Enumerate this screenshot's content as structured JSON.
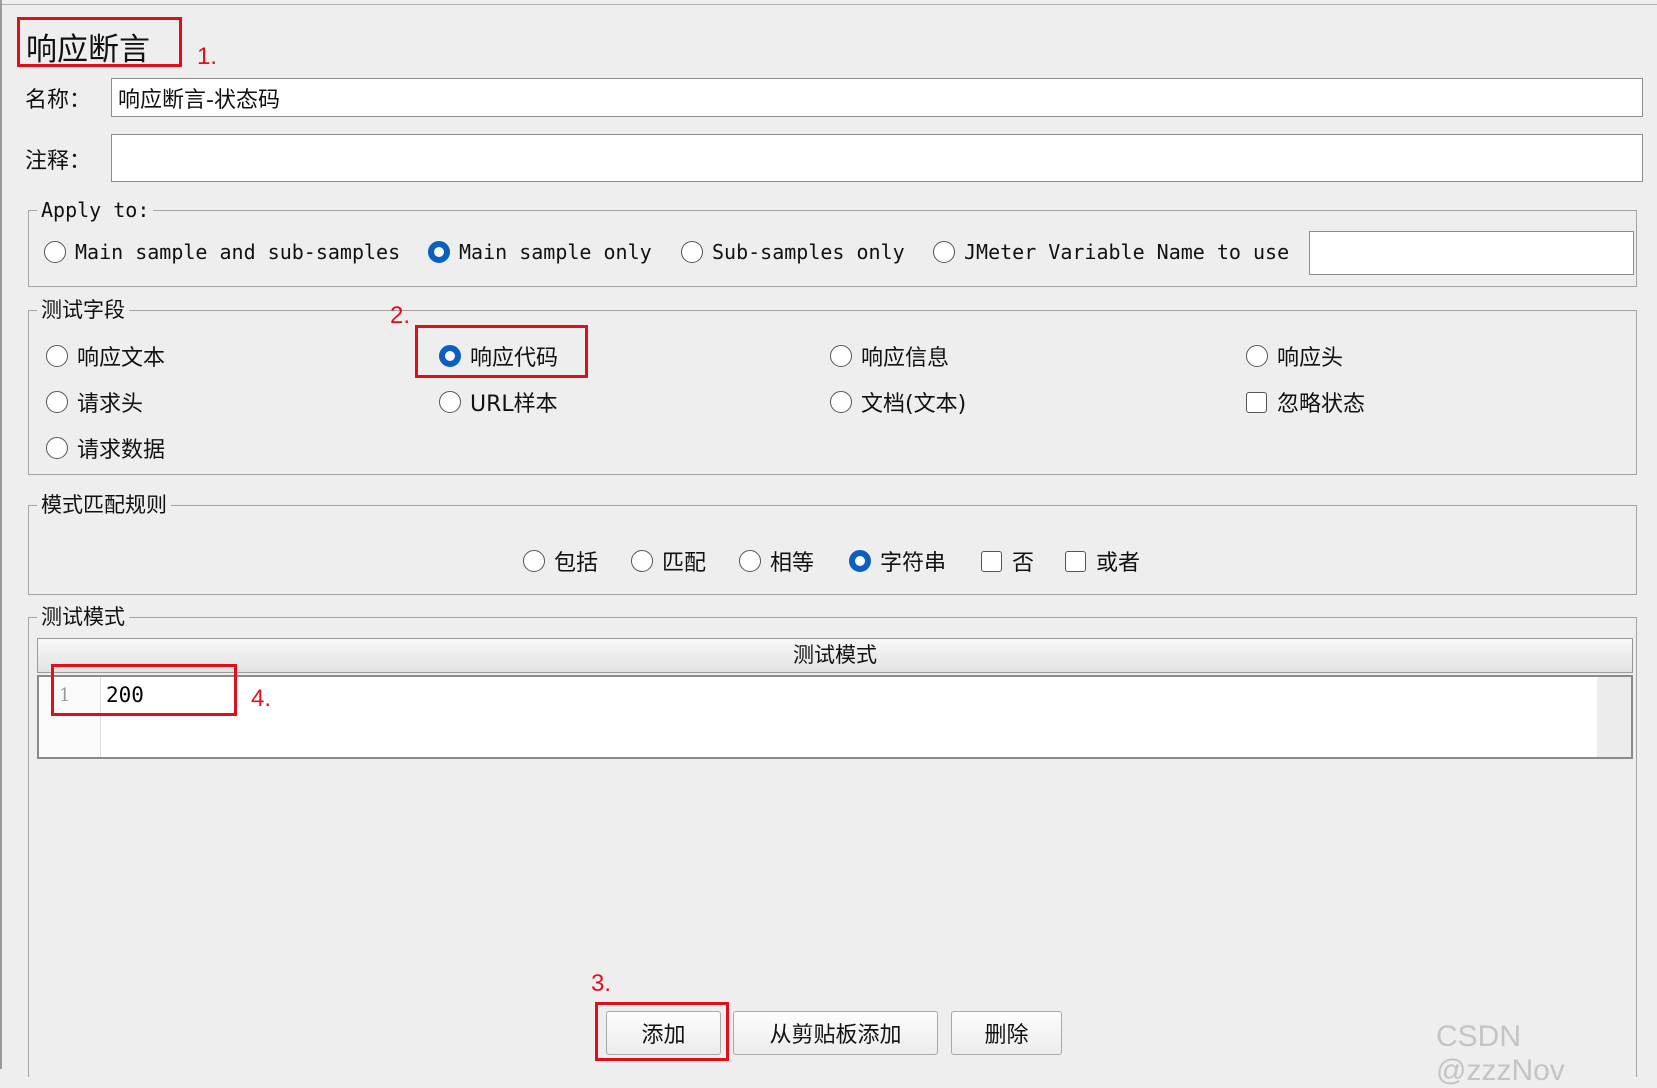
{
  "title": "响应断言",
  "name_field": {
    "label": "名称：",
    "value": "响应断言-状态码"
  },
  "comment_field": {
    "label": "注释：",
    "value": ""
  },
  "apply_to": {
    "legend": "Apply to:",
    "options": [
      {
        "label": "Main sample and sub-samples",
        "selected": false
      },
      {
        "label": "Main sample only",
        "selected": true
      },
      {
        "label": "Sub-samples only",
        "selected": false
      },
      {
        "label": "JMeter Variable Name to use",
        "selected": false
      }
    ],
    "variable_value": ""
  },
  "test_field": {
    "legend": "测试字段",
    "options": [
      {
        "label": "响应文本",
        "selected": false
      },
      {
        "label": "响应代码",
        "selected": true
      },
      {
        "label": "响应信息",
        "selected": false
      },
      {
        "label": "响应头",
        "selected": false
      },
      {
        "label": "请求头",
        "selected": false
      },
      {
        "label": "URL样本",
        "selected": false
      },
      {
        "label": "文档(文本)",
        "selected": false
      },
      {
        "label": "忽略状态",
        "checked": false
      },
      {
        "label": "请求数据",
        "selected": false
      }
    ]
  },
  "match_rules": {
    "legend": "模式匹配规则",
    "options": [
      {
        "label": "包括",
        "selected": false
      },
      {
        "label": "匹配",
        "selected": false
      },
      {
        "label": "相等",
        "selected": false
      },
      {
        "label": "字符串",
        "selected": true
      },
      {
        "label": "否",
        "checked": false
      },
      {
        "label": "或者",
        "checked": false
      }
    ]
  },
  "patterns": {
    "legend": "测试模式",
    "column_header": "测试模式",
    "rows": [
      {
        "index": "1",
        "value": "200"
      }
    ]
  },
  "buttons": {
    "add": "添加",
    "add_clipboard": "从剪贴板添加",
    "delete": "删除"
  },
  "annotations": {
    "n1": "1.",
    "n2": "2.",
    "n3": "3.",
    "n4": "4."
  },
  "watermark": "CSDN @zzzNov",
  "colors": {
    "accent": "#0a5fbf",
    "annotation": "#e0101a"
  }
}
